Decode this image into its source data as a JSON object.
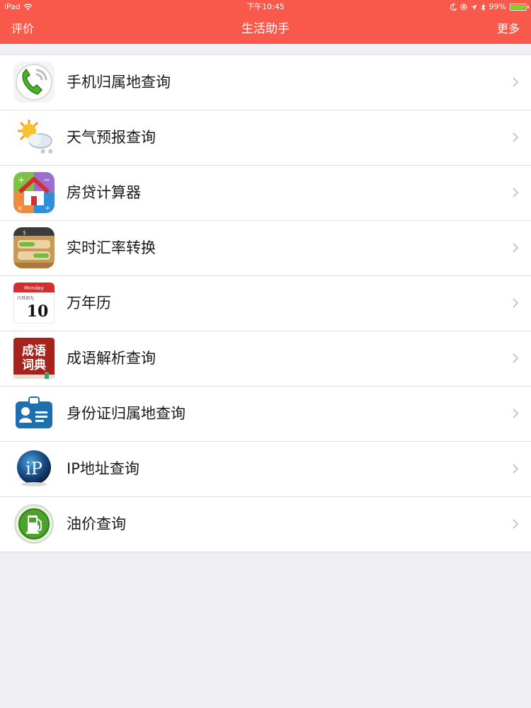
{
  "status": {
    "device": "iPad",
    "time": "下午10:45",
    "battery": "99%",
    "battery_level": 0.99
  },
  "nav": {
    "left": "评价",
    "title": "生活助手",
    "right": "更多"
  },
  "colors": {
    "accent": "#f9594a",
    "background": "#efeef2",
    "chevron": "#c7c7cc"
  },
  "items": [
    {
      "label": "手机归属地查询",
      "icon": "phone-icon"
    },
    {
      "label": "天气预报查询",
      "icon": "weather-icon"
    },
    {
      "label": "房贷计算器",
      "icon": "house-calculator-icon"
    },
    {
      "label": "实时汇率转换",
      "icon": "wallet-icon"
    },
    {
      "label": "万年历",
      "icon": "calendar-icon",
      "icon_text": {
        "day": "Monday",
        "lunar": "六月初九",
        "date": "10"
      }
    },
    {
      "label": "成语解析查询",
      "icon": "dictionary-icon",
      "icon_text": {
        "line1": "成语",
        "line2": "词典"
      }
    },
    {
      "label": "身份证归属地查询",
      "icon": "id-card-icon"
    },
    {
      "label": "IP地址查询",
      "icon": "ip-globe-icon",
      "icon_text": {
        "mark": "iP"
      }
    },
    {
      "label": "油价查询",
      "icon": "fuel-pump-icon"
    }
  ]
}
